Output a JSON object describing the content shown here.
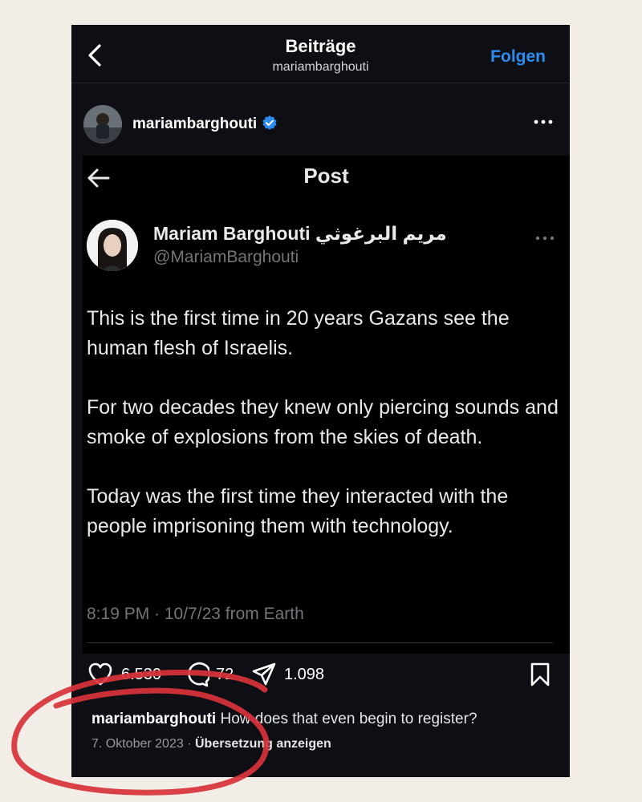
{
  "header": {
    "title": "Beiträge",
    "subtitle": "mariambarghouti",
    "follow_label": "Folgen"
  },
  "account": {
    "username": "mariambarghouti",
    "verified": true
  },
  "embedded_post": {
    "nav_title": "Post",
    "author_name": "Mariam Barghouti مريم البرغوثي",
    "author_handle": "@MariamBarghouti",
    "paragraphs": [
      "This is the first time in 20 years Gazans see the human flesh of Israelis.",
      "For two decades they knew only piercing sounds and smoke of explosions from the skies of death.",
      "Today was the first time they interacted with the people imprisoning them with technology."
    ],
    "meta": "8:19 PM · 10/7/23 from Earth"
  },
  "actions": {
    "likes": "6.530",
    "comments": "72",
    "shares": "1.098"
  },
  "caption": {
    "username": "mariambarghouti",
    "text": "How does that even begin to register?"
  },
  "footer": {
    "date": "7. Oktober 2023",
    "separator": "·",
    "translate_label": "Übersetzung anzeigen"
  },
  "colors": {
    "accent_blue": "#2d8cf0",
    "annotation_red": "#d8323a",
    "page_background": "#f3ede7"
  }
}
